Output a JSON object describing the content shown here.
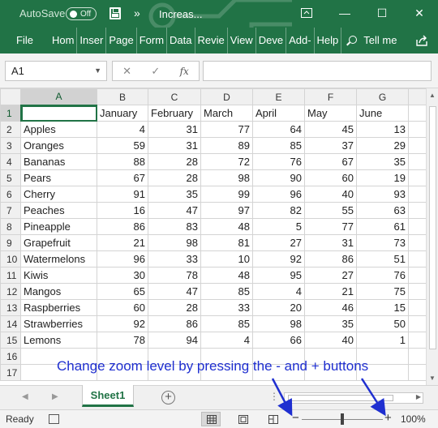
{
  "titlebar": {
    "autosave_label": "AutoSave",
    "autosave_state": "Off",
    "doc_title": "Increas...",
    "min_glyph": "—",
    "max_glyph": "☐",
    "close_glyph": "✕",
    "more_glyph": "»"
  },
  "ribbon": {
    "tabs": [
      "File",
      "Hom",
      "Inser",
      "Page",
      "Form",
      "Data",
      "Revie",
      "View",
      "Deve",
      "Add-",
      "Help"
    ],
    "tell_me": "Tell me"
  },
  "formula_bar": {
    "name_box": "A1",
    "cancel_glyph": "✕",
    "enter_glyph": "✓",
    "fx_glyph": "fx",
    "formula_value": ""
  },
  "sheet": {
    "columns": [
      "A",
      "B",
      "C",
      "D",
      "E",
      "F",
      "G"
    ],
    "rows": [
      {
        "n": "1",
        "cells": [
          "",
          "January",
          "February",
          "March",
          "April",
          "May",
          "June"
        ]
      },
      {
        "n": "2",
        "cells": [
          "Apples",
          "4",
          "31",
          "77",
          "64",
          "45",
          "13"
        ]
      },
      {
        "n": "3",
        "cells": [
          "Oranges",
          "59",
          "31",
          "89",
          "85",
          "37",
          "29"
        ]
      },
      {
        "n": "4",
        "cells": [
          "Bananas",
          "88",
          "28",
          "72",
          "76",
          "67",
          "35"
        ]
      },
      {
        "n": "5",
        "cells": [
          "Pears",
          "67",
          "28",
          "98",
          "90",
          "60",
          "19"
        ]
      },
      {
        "n": "6",
        "cells": [
          "Cherry",
          "91",
          "35",
          "99",
          "96",
          "40",
          "93"
        ]
      },
      {
        "n": "7",
        "cells": [
          "Peaches",
          "16",
          "47",
          "97",
          "82",
          "55",
          "63"
        ]
      },
      {
        "n": "8",
        "cells": [
          "Pineapple",
          "86",
          "83",
          "48",
          "5",
          "77",
          "61"
        ]
      },
      {
        "n": "9",
        "cells": [
          "Grapefruit",
          "21",
          "98",
          "81",
          "27",
          "31",
          "73"
        ]
      },
      {
        "n": "10",
        "cells": [
          "Watermelons",
          "96",
          "33",
          "10",
          "92",
          "86",
          "51"
        ]
      },
      {
        "n": "11",
        "cells": [
          "Kiwis",
          "30",
          "78",
          "48",
          "95",
          "27",
          "76"
        ]
      },
      {
        "n": "12",
        "cells": [
          "Mangos",
          "65",
          "47",
          "85",
          "4",
          "21",
          "75"
        ]
      },
      {
        "n": "13",
        "cells": [
          "Raspberries",
          "60",
          "28",
          "33",
          "20",
          "46",
          "15"
        ]
      },
      {
        "n": "14",
        "cells": [
          "Strawberries",
          "92",
          "86",
          "85",
          "98",
          "35",
          "50"
        ]
      },
      {
        "n": "15",
        "cells": [
          "Lemons",
          "78",
          "94",
          "4",
          "66",
          "40",
          "1"
        ]
      },
      {
        "n": "16",
        "cells": [
          "",
          "",
          "",
          "",
          "",
          "",
          ""
        ]
      },
      {
        "n": "17",
        "cells": [
          "",
          "",
          "",
          "",
          "",
          "",
          ""
        ]
      }
    ]
  },
  "annotation": "Change zoom level by pressing the - and + buttons",
  "sheet_tabs": {
    "active": "Sheet1",
    "add_glyph": "+",
    "dots": "⋮"
  },
  "status": {
    "ready": "Ready",
    "zoom_minus": "−",
    "zoom_plus": "+",
    "zoom_level": "100%",
    "zoom_fraction": 0.5
  },
  "colors": {
    "excel_green": "#217346",
    "annotation_blue": "#1f2fd0"
  }
}
